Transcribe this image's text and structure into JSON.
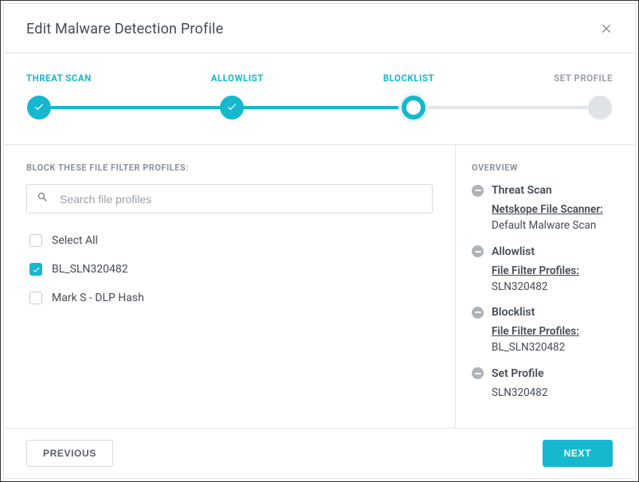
{
  "header": {
    "title": "Edit Malware Detection Profile"
  },
  "stepper": {
    "steps": [
      {
        "label": "THREAT SCAN",
        "state": "done"
      },
      {
        "label": "ALLOWLIST",
        "state": "done"
      },
      {
        "label": "BLOCKLIST",
        "state": "current"
      },
      {
        "label": "SET PROFILE",
        "state": "pending"
      }
    ]
  },
  "blocklist": {
    "heading": "BLOCK THESE FILE FILTER PROFILES:",
    "search_placeholder": "Search file profiles",
    "items": [
      {
        "label": "Select All",
        "checked": false
      },
      {
        "label": "BL_SLN320482",
        "checked": true
      },
      {
        "label": "Mark S - DLP Hash",
        "checked": false
      }
    ]
  },
  "overview": {
    "heading": "OVERVIEW",
    "items": [
      {
        "title": "Threat Scan",
        "sub_label": "Netskope File Scanner:",
        "sub_value": "Default Malware Scan"
      },
      {
        "title": "Allowlist",
        "sub_label": "File Filter Profiles:",
        "sub_value": "SLN320482"
      },
      {
        "title": "Blocklist",
        "sub_label": "File Filter Profiles:",
        "sub_value": "BL_SLN320482"
      },
      {
        "title": "Set Profile",
        "sub_label": "",
        "sub_value": "SLN320482"
      }
    ]
  },
  "footer": {
    "previous": "PREVIOUS",
    "next": "NEXT"
  },
  "colors": {
    "accent": "#15b8ce"
  }
}
